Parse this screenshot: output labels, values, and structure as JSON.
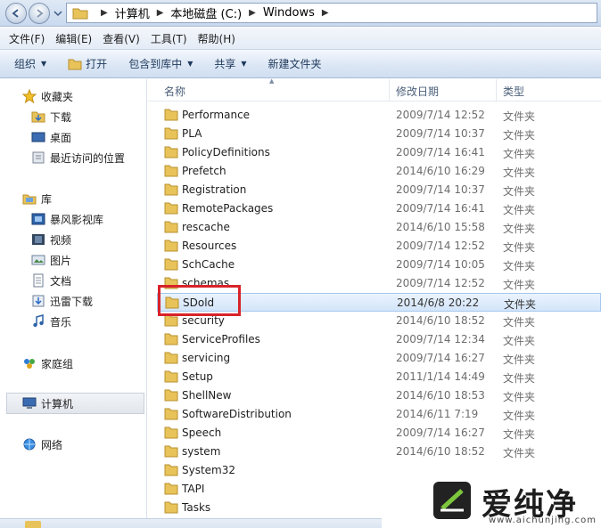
{
  "address": {
    "crumbs": [
      "计算机",
      "本地磁盘 (C:)",
      "Windows"
    ]
  },
  "menu": [
    "文件(F)",
    "编辑(E)",
    "查看(V)",
    "工具(T)",
    "帮助(H)"
  ],
  "toolbar": {
    "organize": "组织",
    "open": "打开",
    "include": "包含到库中",
    "share": "共享",
    "new_folder": "新建文件夹"
  },
  "nav": {
    "favorites": "收藏夹",
    "downloads": "下载",
    "desktop": "桌面",
    "recent": "最近访问的位置",
    "libraries": "库",
    "baofeng": "暴风影视库",
    "videos": "视频",
    "pictures": "图片",
    "documents": "文档",
    "xunlei": "迅雷下载",
    "music": "音乐",
    "homegroup": "家庭组",
    "computer": "计算机",
    "network": "网络"
  },
  "columns": {
    "name": "名称",
    "date": "修改日期",
    "type": "类型"
  },
  "rows": [
    {
      "name": "Performance",
      "date": "2009/7/14 12:52",
      "type": "文件夹"
    },
    {
      "name": "PLA",
      "date": "2009/7/14 10:37",
      "type": "文件夹"
    },
    {
      "name": "PolicyDefinitions",
      "date": "2009/7/14 16:41",
      "type": "文件夹"
    },
    {
      "name": "Prefetch",
      "date": "2014/6/10 16:29",
      "type": "文件夹"
    },
    {
      "name": "Registration",
      "date": "2009/7/14 10:37",
      "type": "文件夹"
    },
    {
      "name": "RemotePackages",
      "date": "2009/7/14 16:41",
      "type": "文件夹"
    },
    {
      "name": "rescache",
      "date": "2014/6/10 15:58",
      "type": "文件夹"
    },
    {
      "name": "Resources",
      "date": "2009/7/14 12:52",
      "type": "文件夹"
    },
    {
      "name": "SchCache",
      "date": "2009/7/14 10:05",
      "type": "文件夹"
    },
    {
      "name": "schemas",
      "date": "2009/7/14 12:52",
      "type": "文件夹"
    },
    {
      "name": "SDold",
      "date": "2014/6/8 20:22",
      "type": "文件夹"
    },
    {
      "name": "security",
      "date": "2014/6/10 18:52",
      "type": "文件夹"
    },
    {
      "name": "ServiceProfiles",
      "date": "2009/7/14 12:34",
      "type": "文件夹"
    },
    {
      "name": "servicing",
      "date": "2009/7/14 16:27",
      "type": "文件夹"
    },
    {
      "name": "Setup",
      "date": "2011/1/14 14:49",
      "type": "文件夹"
    },
    {
      "name": "ShellNew",
      "date": "2014/6/10 18:53",
      "type": "文件夹"
    },
    {
      "name": "SoftwareDistribution",
      "date": "2014/6/11 7:19",
      "type": "文件夹"
    },
    {
      "name": "Speech",
      "date": "2009/7/14 16:27",
      "type": "文件夹"
    },
    {
      "name": "system",
      "date": "2014/6/10 18:52",
      "type": "文件夹"
    },
    {
      "name": "System32",
      "date": "",
      "type": ""
    },
    {
      "name": "TAPI",
      "date": "",
      "type": ""
    },
    {
      "name": "Tasks",
      "date": "",
      "type": ""
    }
  ],
  "selected_row": "SDold",
  "watermark": {
    "brand": "爱纯净",
    "url": "www.aichunjing.com"
  },
  "colors": {
    "selection": "#d3e5fa",
    "highlight_box": "#d8232a",
    "folder": "#e8c35a"
  }
}
